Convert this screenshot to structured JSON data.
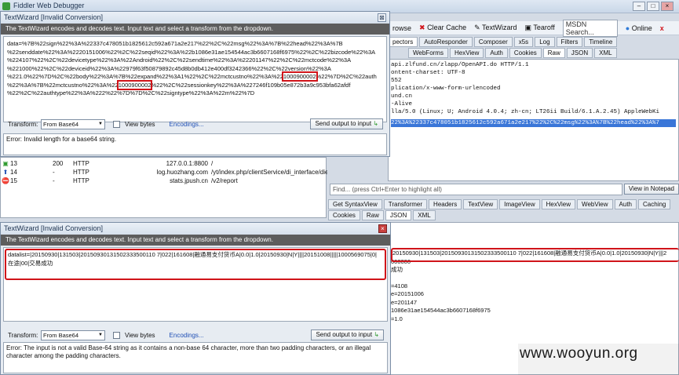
{
  "app": {
    "title": "Fiddler Web Debugger"
  },
  "toolbar": {
    "browse": "rowse",
    "clear_cache": "Clear Cache",
    "textwizard": "TextWizard",
    "tearoff": "Tearoff",
    "msdn_placeholder": "MSDN Search...",
    "online": "Online"
  },
  "inspector_tabs": [
    "pectors",
    "AutoResponder",
    "Composer",
    "x5s",
    "Log",
    "Filters",
    "Timeline"
  ],
  "request_tabs": [
    "WebForms",
    "HexView",
    "Auth",
    "Cookies",
    "Raw",
    "JSON",
    "XML"
  ],
  "request_raw": [
    "api.zlfund.cn/zlapp/OpenAPI.do HTTP/1.1",
    "ontent-charset: UTF-8",
    "552",
    "plication/x-www-form-urlencoded",
    "und.cn",
    "-Alive",
    "lla/5.0 (Linux; U; Android 4.0.4; zh-cn; LT26ii Build/6.1.A.2.45) AppleWebKi"
  ],
  "request_selected_line": "22%3A%22337c478051b1825612c592a671a2e217%22%2C%22msg%22%3A%7B%22head%22%3A%7",
  "find": {
    "placeholder": "Find... (press Ctrl+Enter to highlight all)",
    "button": "View in Notepad"
  },
  "response_tabs_row1": [
    "Get SyntaxView",
    "Transformer",
    "Headers",
    "TextView",
    "ImageView",
    "HexView",
    "WebView",
    "Auth",
    "Caching"
  ],
  "response_tabs_row2": [
    "Cookies",
    "Raw",
    "JSON",
    "XML"
  ],
  "response_lines": [
    "|20150930|131503|20150930131502333500110 7|022|161608|融通易支付货币A|0.0|1.0|20150930|N|Y|||2",
    "000000",
    "成功",
    "",
    "=4108",
    "e=20151006",
    "e=201147",
    "1086e31ae154544ac3b6607168f6975",
    "=1.0"
  ],
  "sessions": [
    {
      "num": "13",
      "result": "200",
      "protocol": "HTTP",
      "host": "127.0.0.1:8800",
      "url": "/"
    },
    {
      "num": "14",
      "result": "-",
      "protocol": "HTTP",
      "host": "log.huozhang.com",
      "url": "/yt/index.php/clientService/di_interface/die"
    },
    {
      "num": "15",
      "result": "-",
      "protocol": "HTTP",
      "host": "stats.jpush.cn",
      "url": "/v2/report"
    }
  ],
  "tw1": {
    "title": "TextWizard [Invalid Conversion]",
    "banner": "The TextWizard encodes and decodes text. Input text and select a transform from the dropdown.",
    "input_lines": [
      "data=%7B%22sign%22%3A%22337c478051b1825612c592a671a2e217%22%2C%22msg%22%3A%7B%22head%22%3A%7B",
      "%22senddate%22%3A%2220151006%22%2C%22seqid%22%3A%22b1086e31ae154544ac3b6607168f6975%22%2C%22bizcode%22%3A",
      "%224107%22%2C%22devicetype%22%3A%22Android%22%2C%22sendtime%22%3A%22201147%22%2C%22mctcode%22%3A",
      "%221000%22%2C%22deviceid%22%3A%22979f63f50879892c45d8b0db412e400df3242366%22%2C%22version%22%3A",
      "%221.0%22%7D%2C%22body%22%3A%7B%22expand%22%3A1%22%2C%22mctcustno%22%3A%22",
      "1000900002",
      "%22%7D%2C%22auth",
      "%22%3A%7B%22mctcustno%22%3A%22",
      "1000900002",
      "%22%2C%22sessionkey%22%3A%227246f109b05e872b3a9c953bfa62afdf",
      "%22%2C%22authtype%22%3A%222%22%7D%7D%2C%22signtype%22%3A%22m%22%7D"
    ],
    "transform_label": "Transform:",
    "transform_value": "From Base64",
    "view_bytes": "View bytes",
    "encodings": "Encodings...",
    "send_button": "Send output to input",
    "error": "Error: Invalid length for a base64 string."
  },
  "tw2": {
    "title": "TextWizard [Invalid Conversion]",
    "banner": "The TextWizard encodes and decodes text. Input text and select a transform from the dropdown.",
    "input": "datalist=|20150930|131503|20150930131502333500110 7|022|161608|融通易支付货币A|0.0|1.0|20150930|N|Y||||20151008|||||1000569075|0|在途|00|交易成功",
    "transform_label": "Transform:",
    "transform_value": "From Base64",
    "view_bytes": "View bytes",
    "encodings": "Encodings...",
    "send_button": "Send output to input",
    "error": "Error: The input is not a valid Base-64 string as it contains a non-base 64 character, more than two padding characters, or an illegal character among the padding characters."
  },
  "watermark": "www.wooyun.org",
  "colors": {
    "highlight": "#d0141a",
    "banner": "#5d5d5d",
    "selected_line": "#3a76d8"
  }
}
